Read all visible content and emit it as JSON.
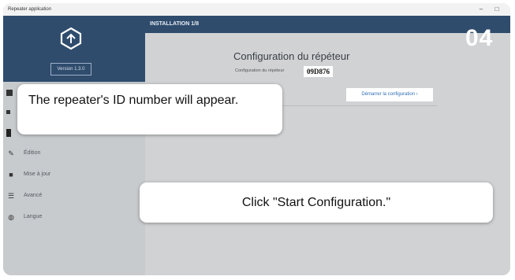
{
  "window": {
    "title": "Repeater application",
    "minimize_glyph": "–",
    "maximize_glyph": "□"
  },
  "sidebar": {
    "version": "Version 1.3.0",
    "logo_icon": "repeater-logo-icon",
    "items": [
      {
        "label": "Édition",
        "icon": "edit-icon"
      },
      {
        "label": "Mise à jour",
        "icon": "update-icon"
      },
      {
        "label": "Avancé",
        "icon": "sliders-icon"
      },
      {
        "label": "Langue",
        "icon": "globe-icon"
      }
    ]
  },
  "header": {
    "title": "INSTALLATION 1/8"
  },
  "config": {
    "title": "Configuration du répéteur",
    "subtitle": "Configuration du répéteur",
    "repeater_id": "09D876",
    "start_button": "Démarrer la configuration ›"
  },
  "overlay": {
    "step_number": "04",
    "callout_id": "The repeater's ID number will appear.",
    "callout_click": "Click \"Start Configuration.\""
  },
  "colors": {
    "sidebar_header": "#2f4c6d",
    "background": "#d0d2d4",
    "link": "#2f6eb5"
  }
}
